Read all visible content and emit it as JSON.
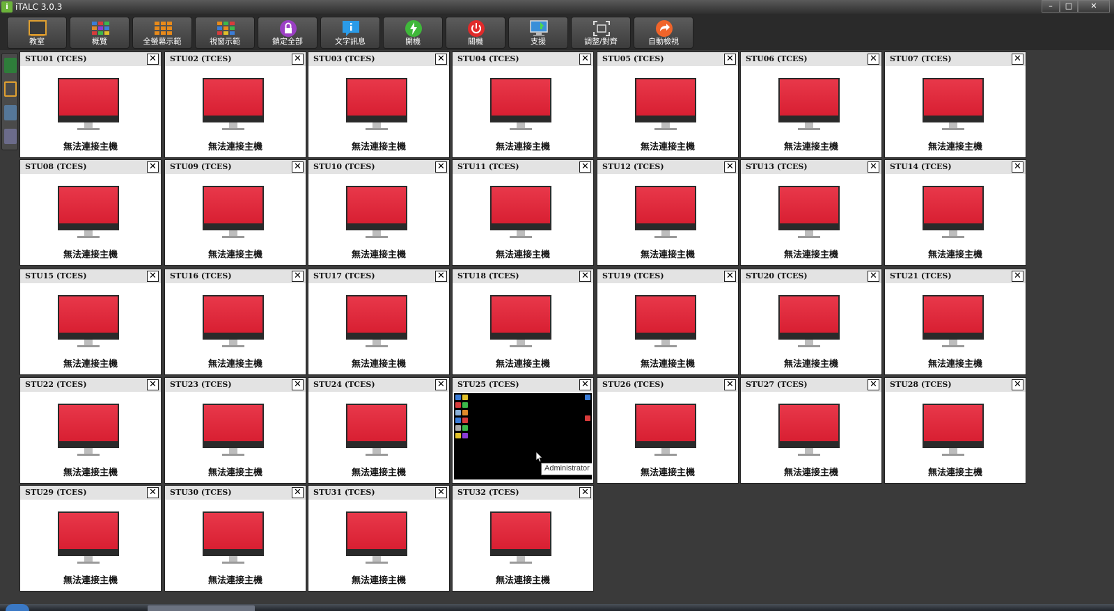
{
  "window": {
    "title": "iTALC 3.0.3",
    "app_icon": "i",
    "controls": {
      "minimize": "–",
      "maximize": "□",
      "close": "✕"
    }
  },
  "toolbar": {
    "buttons": [
      {
        "id": "classroom",
        "label": "教室",
        "icon": "classroom-icon"
      },
      {
        "id": "overview",
        "label": "概覽",
        "icon": "overview-icon"
      },
      {
        "id": "fullscreen-demo",
        "label": "全螢幕示範",
        "icon": "fullscreen-demo-icon"
      },
      {
        "id": "window-demo",
        "label": "視窗示範",
        "icon": "window-demo-icon"
      },
      {
        "id": "lock-all",
        "label": "鎖定全部",
        "icon": "lock-icon"
      },
      {
        "id": "text-message",
        "label": "文字訊息",
        "icon": "message-icon"
      },
      {
        "id": "power-on",
        "label": "開機",
        "icon": "power-on-icon"
      },
      {
        "id": "power-off",
        "label": "關機",
        "icon": "power-off-icon"
      },
      {
        "id": "support",
        "label": "支援",
        "icon": "support-icon"
      },
      {
        "id": "adjust-align",
        "label": "調整/對齊",
        "icon": "adjust-align-icon"
      },
      {
        "id": "auto-view",
        "label": "自動檢視",
        "icon": "auto-view-icon"
      }
    ]
  },
  "tiles": {
    "status_text": "無法連接主機",
    "close_label": "✕",
    "items": [
      "STU01 (TCES)",
      "STU02 (TCES)",
      "STU03 (TCES)",
      "STU04 (TCES)",
      "STU05 (TCES)",
      "STU06 (TCES)",
      "STU07 (TCES)",
      "STU08 (TCES)",
      "STU09 (TCES)",
      "STU10 (TCES)",
      "STU11 (TCES)",
      "STU12 (TCES)",
      "STU13 (TCES)",
      "STU14 (TCES)",
      "STU15 (TCES)",
      "STU16 (TCES)",
      "STU17 (TCES)",
      "STU18 (TCES)",
      "STU19 (TCES)",
      "STU20 (TCES)",
      "STU21 (TCES)",
      "STU22 (TCES)",
      "STU23 (TCES)",
      "STU24 (TCES)",
      "STU25 (TCES)",
      "STU26 (TCES)",
      "STU27 (TCES)",
      "STU28 (TCES)",
      "STU29 (TCES)",
      "STU30 (TCES)",
      "STU31 (TCES)",
      "STU32 (TCES)"
    ],
    "connected_index": 24,
    "connected_tooltip": "Administrator"
  },
  "colors": {
    "monitor_red": "#d81f32",
    "background": "#3a3a3a"
  }
}
